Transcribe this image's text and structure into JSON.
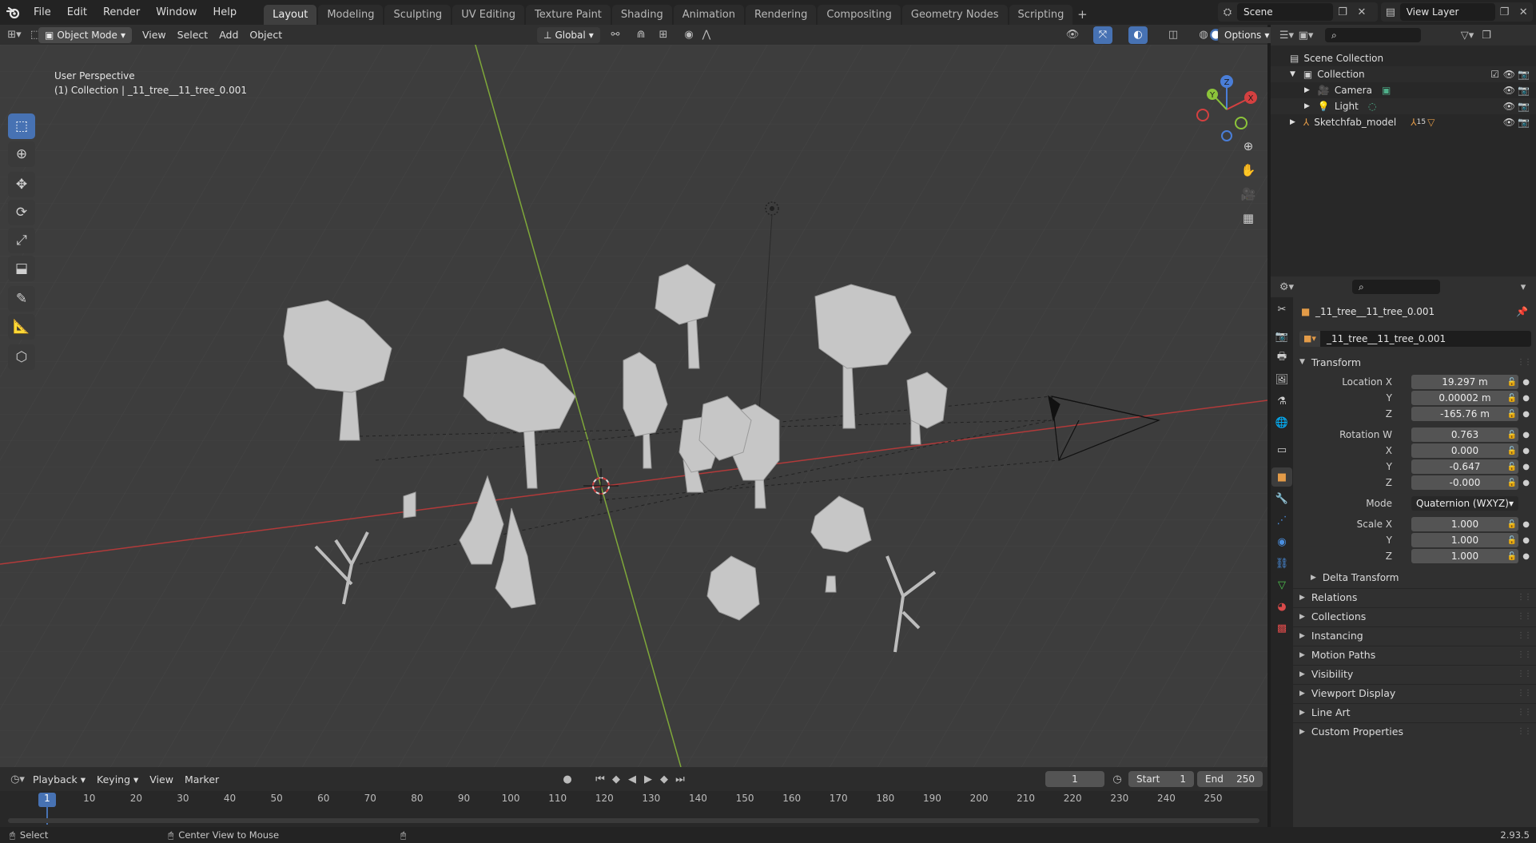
{
  "topbar": {
    "menu": [
      "File",
      "Edit",
      "Render",
      "Window",
      "Help"
    ],
    "workspaces": [
      "Layout",
      "Modeling",
      "Sculpting",
      "UV Editing",
      "Texture Paint",
      "Shading",
      "Animation",
      "Rendering",
      "Compositing",
      "Geometry Nodes",
      "Scripting"
    ],
    "active_workspace": "Layout",
    "scene_name": "Scene",
    "view_layer": "View Layer"
  },
  "viewport_header": {
    "mode": "Object Mode",
    "menus": [
      "View",
      "Select",
      "Add",
      "Object"
    ],
    "orientation": "Global",
    "options_label": "Options"
  },
  "viewport": {
    "perspective_label": "User Perspective",
    "collection_label": "(1) Collection | _11_tree__11_tree_0.001",
    "gizmo_axes": [
      "X",
      "Y",
      "Z"
    ]
  },
  "toolbar": {
    "tools": [
      "select-box",
      "cursor",
      "move",
      "rotate",
      "scale",
      "transform",
      "annotate",
      "measure",
      "add-cube"
    ]
  },
  "timeline": {
    "menus": [
      "Playback",
      "Keying",
      "View",
      "Marker"
    ],
    "current_frame": "1",
    "start_label": "Start",
    "start_value": "1",
    "end_label": "End",
    "end_value": "250",
    "ticks": [
      "1",
      "10",
      "20",
      "30",
      "40",
      "50",
      "60",
      "70",
      "80",
      "90",
      "100",
      "110",
      "120",
      "130",
      "140",
      "150",
      "160",
      "170",
      "180",
      "190",
      "200",
      "210",
      "220",
      "230",
      "240",
      "250"
    ]
  },
  "statusbar": {
    "select": "Select",
    "center_view": "Center View to Mouse",
    "version": "2.93.5"
  },
  "outliner": {
    "rows": [
      {
        "label": "Scene Collection"
      },
      {
        "label": "Collection"
      },
      {
        "label": "Camera"
      },
      {
        "label": "Light"
      },
      {
        "label": "Sketchfab_model",
        "badge": "15"
      }
    ]
  },
  "properties": {
    "object_name": "_11_tree__11_tree_0.001",
    "object_name_field": "_11_tree__11_tree_0.001",
    "transform_title": "Transform",
    "location": {
      "labels": [
        "Location X",
        "Y",
        "Z"
      ],
      "values": [
        "19.297 m",
        "0.00002 m",
        "-165.76 m"
      ]
    },
    "rotation": {
      "labels": [
        "Rotation W",
        "X",
        "Y",
        "Z"
      ],
      "values": [
        "0.763",
        "0.000",
        "-0.647",
        "-0.000"
      ]
    },
    "mode_label": "Mode",
    "mode_value": "Quaternion (WXYZ)",
    "scale": {
      "labels": [
        "Scale X",
        "Y",
        "Z"
      ],
      "values": [
        "1.000",
        "1.000",
        "1.000"
      ]
    },
    "delta_transform": "Delta Transform",
    "sections": [
      "Relations",
      "Collections",
      "Instancing",
      "Motion Paths",
      "Visibility",
      "Viewport Display",
      "Line Art",
      "Custom Properties"
    ]
  },
  "colors": {
    "accent": "#4772b3",
    "x_axis": "#d44040",
    "y_axis": "#8cc43a",
    "viewport_bg": "#3d3d3d"
  }
}
